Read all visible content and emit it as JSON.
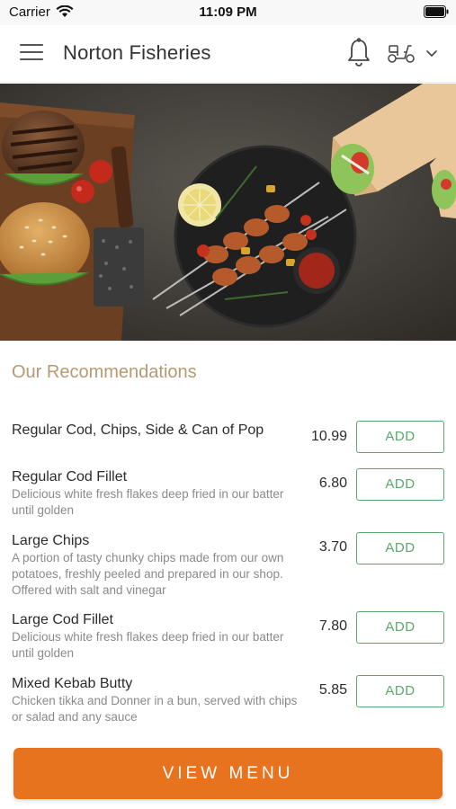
{
  "status_bar": {
    "carrier": "Carrier",
    "time": "11:09 PM"
  },
  "header": {
    "title": "Norton Fisheries",
    "icons": [
      "menu-icon",
      "bell-icon",
      "scooter-icon",
      "chevron-down-icon"
    ]
  },
  "hero": {
    "image": "food-platter-photo"
  },
  "recommendations": {
    "title": "Our Recommendations",
    "items": [
      {
        "name": "Regular Cod, Chips, Side & Can of Pop",
        "description": "",
        "price": "10.99",
        "button": "ADD"
      },
      {
        "name": "Regular Cod Fillet",
        "description": "Delicious white fresh flakes deep fried in our batter until golden",
        "price": "6.80",
        "button": "ADD"
      },
      {
        "name": "Large Chips",
        "description": "A portion of tasty chunky chips made from our own potatoes, freshly peeled and prepared in our shop. Offered with salt and vinegar",
        "price": "3.70",
        "button": "ADD"
      },
      {
        "name": "Large Cod Fillet",
        "description": "Delicious white fresh flakes deep fried in our batter until golden",
        "price": "7.80",
        "button": "ADD"
      },
      {
        "name": "Mixed Kebab Butty",
        "description": "Chicken tikka and Donner in a bun, served with chips or salad and any sauce",
        "price": "5.85",
        "button": "ADD"
      }
    ]
  },
  "footer": {
    "view_menu": "VIEW MENU"
  },
  "colors": {
    "accent": "#e8731f",
    "add_button": "#5aa86c",
    "section_title": "#b59a72"
  }
}
